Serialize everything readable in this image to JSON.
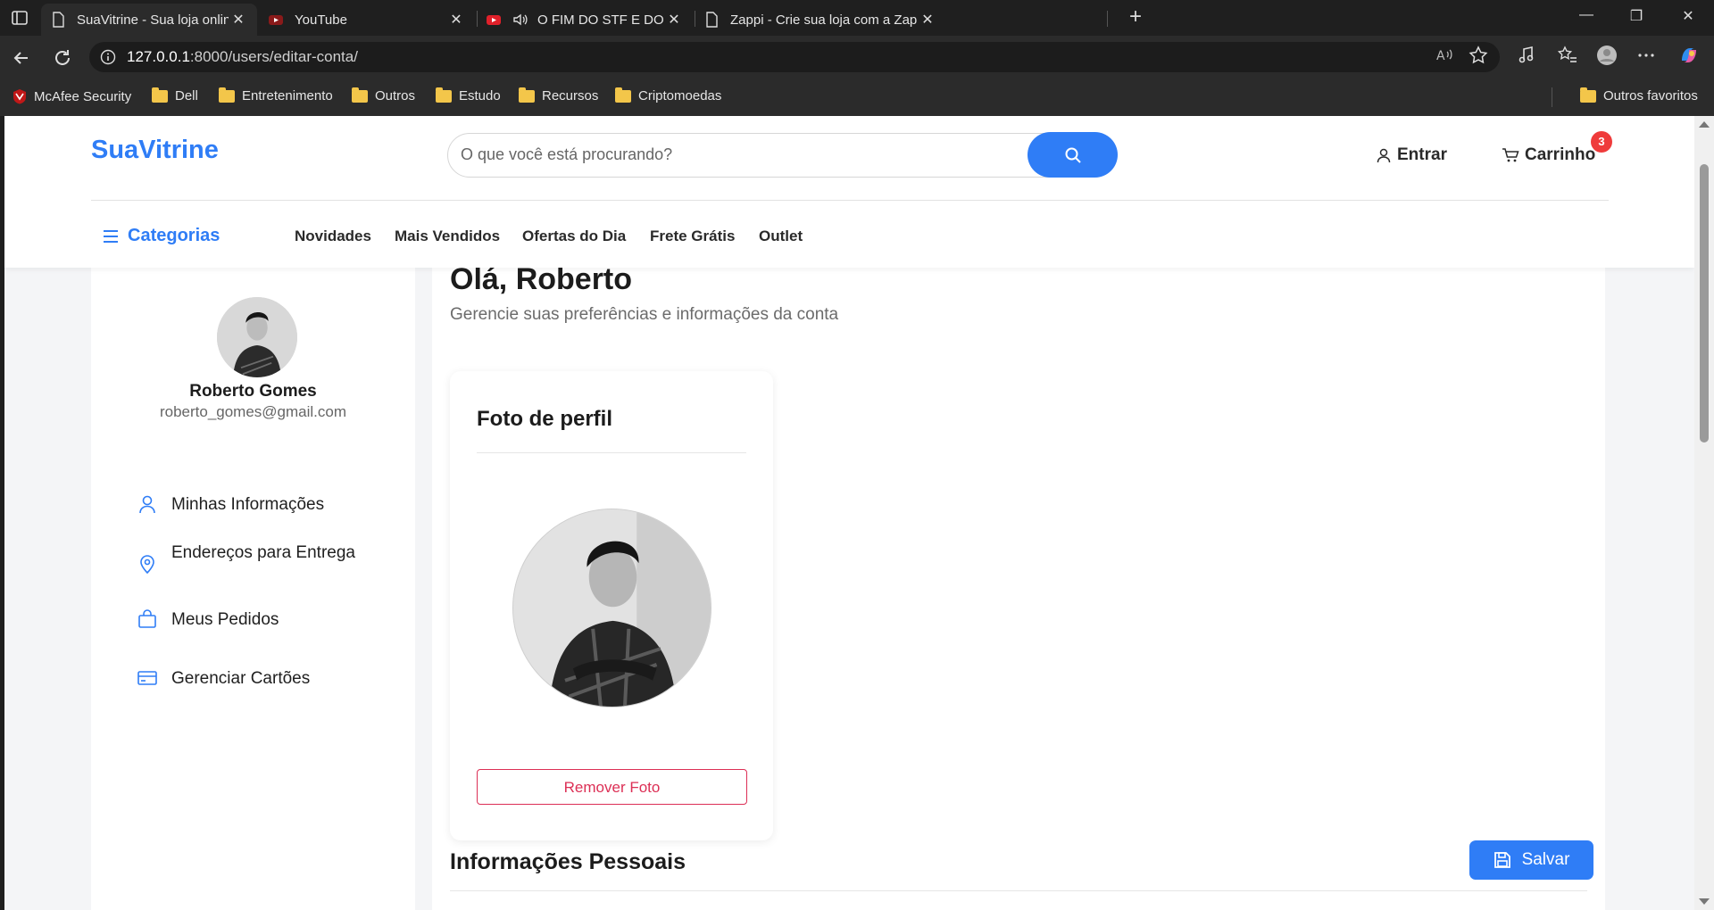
{
  "browser": {
    "tabs": [
      {
        "title": "SuaVitrine - Sua loja online",
        "active": true
      },
      {
        "title": "YouTube",
        "active": false
      },
      {
        "title": "O FIM DO STF E DO BOLSON",
        "active": false
      },
      {
        "title": "Zappi - Crie sua loja com a Zappi",
        "active": false
      }
    ],
    "url_host": "127.0.0.1",
    "url_path": ":8000/users/editar-conta/",
    "bookmarks": [
      "McAfee Security",
      "Dell",
      "Entretenimento",
      "Outros",
      "Estudo",
      "Recursos",
      "Criptomoedas"
    ],
    "other_favorites": "Outros favoritos"
  },
  "header": {
    "logo": "SuaVitrine",
    "search_placeholder": "O que você está procurando?",
    "login_label": "Entrar",
    "cart_label": "Carrinho",
    "cart_count": "3",
    "categories_label": "Categorias",
    "nav": [
      "Novidades",
      "Mais Vendidos",
      "Ofertas do Dia",
      "Frete Grátis",
      "Outlet"
    ]
  },
  "sidebar": {
    "user_name": "Roberto Gomes",
    "user_email": "roberto_gomes@gmail.com",
    "items": [
      {
        "label": "Minhas Informações",
        "icon": "user-icon"
      },
      {
        "label": "Endereços para Entrega",
        "icon": "map-pin-icon"
      },
      {
        "label": "Meus Pedidos",
        "icon": "shopping-bag-icon"
      },
      {
        "label": "Gerenciar Cartões",
        "icon": "credit-card-icon"
      }
    ]
  },
  "main": {
    "greeting": "Olá, Roberto",
    "subtitle": "Gerencie suas preferências e informações da conta",
    "photo_card_title": "Foto de perfil",
    "remove_photo_label": "Remover Foto",
    "section_title": "Informações Pessoais",
    "save_label": "Salvar"
  },
  "colors": {
    "brand": "#2f7df6",
    "danger": "#dc2f55",
    "badge": "#ef3b3b"
  }
}
